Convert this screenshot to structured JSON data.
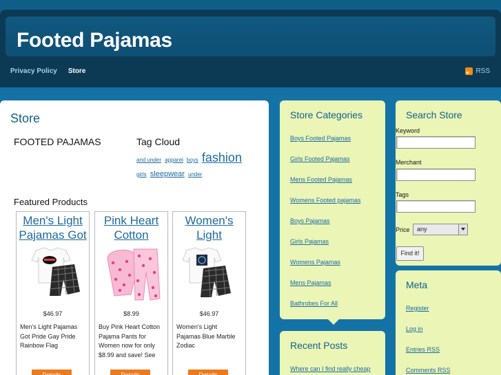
{
  "header": {
    "site_title": "Footed Pajamas",
    "nav": [
      {
        "label": "Privacy Policy"
      },
      {
        "label": "Store"
      }
    ],
    "rss_label": "RSS"
  },
  "main": {
    "page_title": "Store",
    "section_heading": "FOOTED PAJAMAS",
    "tag_cloud_heading": "Tag Cloud",
    "tags": [
      {
        "label": "and under"
      },
      {
        "label": "apparel"
      },
      {
        "label": "boys"
      },
      {
        "label": "fashion"
      },
      {
        "label": "girls"
      },
      {
        "label": "sleepwear"
      },
      {
        "label": "under"
      }
    ],
    "featured_heading": "Featured Products",
    "products": [
      {
        "title": "Men's Light Pajamas Got",
        "price": "$46.97",
        "description": "Men's Light Pajamas Got Pride Gay Pride Rainbow Flag",
        "button": "Details"
      },
      {
        "title": "Pink Heart Cotton",
        "price": "$8.99",
        "description": "Buy Pink Heart Cotton Pajama Pants for Women now for only $8.99 and save! See",
        "button": "Details"
      },
      {
        "title": "Women's Light",
        "price": "$46.97",
        "description": "Women's Light Pajamas Blue Marble Zodiac",
        "button": "Details"
      }
    ]
  },
  "store_categories": {
    "title": "Store Categories",
    "items": [
      {
        "label": "Boys Footed Pajamas"
      },
      {
        "label": "Girls Footed Pajamas"
      },
      {
        "label": "Mens Footed Pajamas"
      },
      {
        "label": "Womens Footed pajamas"
      },
      {
        "label": "Boys Pajamas"
      },
      {
        "label": "Girls Pajamas"
      },
      {
        "label": "Womens Pajamas"
      },
      {
        "label": "Mens Pajamas"
      },
      {
        "label": "Bathrobes For All"
      }
    ]
  },
  "recent_posts": {
    "title": "Recent Posts",
    "items": [
      {
        "label": "Where can I find really cheap"
      }
    ]
  },
  "search_store": {
    "title": "Search Store",
    "keyword_label": "Keyword",
    "merchant_label": "Merchant",
    "tags_label": "Tags",
    "price_label": "Price",
    "price_value": "any",
    "submit_label": "Find it!"
  },
  "meta": {
    "title": "Meta",
    "items": [
      {
        "label": "Register"
      },
      {
        "label": "Log in"
      },
      {
        "label": "Entries RSS"
      },
      {
        "label": "Comments RSS"
      }
    ]
  },
  "colors": {
    "background": "#1473a6",
    "header": "#0c3a55",
    "widget": "#eaf5b6",
    "link": "#1b6aa0",
    "button": "#ec7a1d"
  }
}
